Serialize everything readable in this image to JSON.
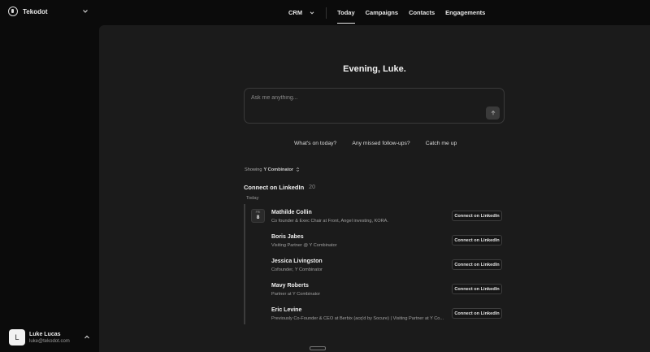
{
  "workspace": {
    "name": "Tekodot"
  },
  "nav": {
    "crm_label": "CRM",
    "items": [
      {
        "label": "Today",
        "active": true
      },
      {
        "label": "Campaigns",
        "active": false
      },
      {
        "label": "Contacts",
        "active": false
      },
      {
        "label": "Engagements",
        "active": false
      }
    ]
  },
  "user": {
    "initial": "L",
    "name": "Luke Lucas",
    "email": "luke@tekodot.com"
  },
  "main": {
    "greeting": "Evening, Luke.",
    "ask_placeholder": "Ask me anything...",
    "suggestions": [
      "What's on today?",
      "Any missed follow-ups?",
      "Catch me up"
    ],
    "showing_label": "Showing",
    "showing_value": "Y Combinator",
    "section_title": "Connect on LinkedIn",
    "section_count": "20",
    "today_label": "Today",
    "date_badge": {
      "dow": "FRI",
      "day": "8"
    },
    "button_label": "Connect on LinkedIn",
    "contacts": [
      {
        "name": "Mathilde Collin",
        "subtitle": "Co founder & Exec Chair at Front, Angel investing, KORA."
      },
      {
        "name": "Boris Jabes",
        "subtitle": "Visiting Partner @ Y Combinator"
      },
      {
        "name": "Jessica Livingston",
        "subtitle": "Cofounder, Y Combinator"
      },
      {
        "name": "Mavy Roberts",
        "subtitle": "Partner at Y Combinator"
      },
      {
        "name": "Eric Levine",
        "subtitle": "Previously Co-Founder & CEO at Berbix (acq'd by Socure) | Visiting Partner at Y Co..."
      }
    ]
  },
  "icons": {
    "brand": "tekodot-logo-icon",
    "chevron": "chevron-down-icon",
    "send": "arrow-up-icon",
    "sort": "sort-icon"
  }
}
